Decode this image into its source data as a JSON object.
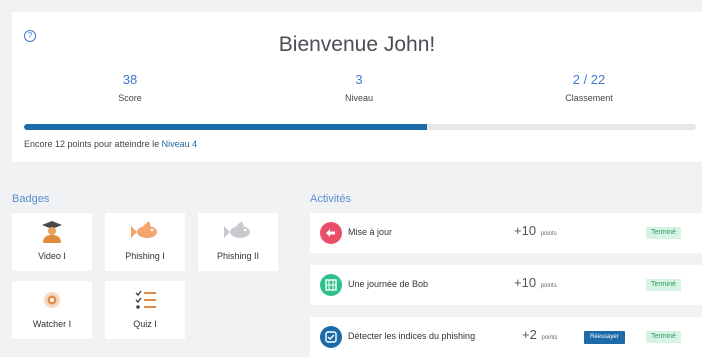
{
  "header": {
    "help_glyph": "?",
    "welcome": "Bienvenue John!"
  },
  "stats": [
    {
      "value": "38",
      "label": "Score"
    },
    {
      "value": "3",
      "label": "Niveau"
    },
    {
      "value": "2 / 22",
      "label": "Classement"
    }
  ],
  "progress": {
    "fraction": 0.6,
    "text_before": "Encore 12 points pour atteindre le ",
    "level_link": "Niveau 4"
  },
  "badges": {
    "title": "Badges",
    "items": [
      {
        "name": "Video I",
        "icon": "graduate-icon"
      },
      {
        "name": "Phishing I",
        "icon": "fish-icon"
      },
      {
        "name": "Phishing II",
        "icon": "fish-icon"
      },
      {
        "name": "Watcher I",
        "icon": "eye-icon"
      },
      {
        "name": "Quiz I",
        "icon": "checklist-icon"
      }
    ]
  },
  "activities": {
    "title": "Activités",
    "items": [
      {
        "title": "Mise à jour",
        "points": "+10",
        "unit": "points",
        "status": "Terminé",
        "icon": "update-icon",
        "color": "#e94f6a"
      },
      {
        "title": "Une journée de Bob",
        "points": "+10",
        "unit": "points",
        "status": "Terminé",
        "icon": "film-icon",
        "color": "#2ec08a"
      },
      {
        "title": "Détecter les indices du phishing",
        "points": "+2",
        "unit": "points",
        "status": "Terminé",
        "retry": "Réessayer",
        "icon": "check-icon",
        "color": "#1c6aa7"
      }
    ]
  },
  "colors": {
    "accent": "#3f7bd0",
    "progress": "#1c6aa7",
    "success_bg": "#d7f3e4",
    "success_text": "#2a9a64"
  }
}
